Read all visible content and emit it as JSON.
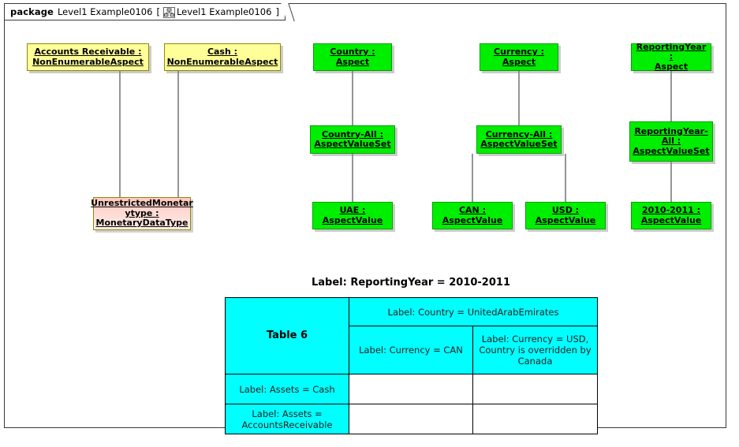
{
  "package": {
    "keyword": "package",
    "name": "Level1 Example0106",
    "open_bracket": "[",
    "close_bracket": "]",
    "tab_name": "Level1 Example0106",
    "icon": "class-diagram-icon"
  },
  "nodes": [
    {
      "id": "accounts-receivable",
      "line1": "Accounts Receivable :",
      "line2": "NonEnumerableAspect",
      "color": "#ffff99",
      "kind": "yellow"
    },
    {
      "id": "cash",
      "line1": "Cash :",
      "line2": "NonEnumerableAspect",
      "color": "#ffff99",
      "kind": "yellow"
    },
    {
      "id": "unrestricted-monetarytype",
      "line1": "UnrestrictedMonetar",
      "line2": "ytype :",
      "line3": "MonetaryDataType",
      "color": "#ffc9c0",
      "kind": "pink"
    },
    {
      "id": "country-aspect",
      "line1": "Country :",
      "line2": "Aspect",
      "color": "#00ee00",
      "kind": "green"
    },
    {
      "id": "country-all",
      "line1": "Country-All :",
      "line2": "AspectValueSet",
      "color": "#00ee00",
      "kind": "green"
    },
    {
      "id": "uae-aspectvalue",
      "line1": "UAE :",
      "line2": "AspectValue",
      "color": "#00ee00",
      "kind": "green"
    },
    {
      "id": "currency-aspect",
      "line1": "Currency :",
      "line2": "Aspect",
      "color": "#00ee00",
      "kind": "green"
    },
    {
      "id": "currency-all",
      "line1": "Currency-All :",
      "line2": "AspectValueSet",
      "color": "#00ee00",
      "kind": "green"
    },
    {
      "id": "can-aspectvalue",
      "line1": "CAN :",
      "line2": "AspectValue",
      "color": "#00ee00",
      "kind": "green"
    },
    {
      "id": "usd-aspectvalue",
      "line1": "USD :",
      "line2": "AspectValue",
      "color": "#00ee00",
      "kind": "green"
    },
    {
      "id": "reportingyear-aspect",
      "line1": "ReportingYear :",
      "line2": "Aspect",
      "color": "#00ee00",
      "kind": "green"
    },
    {
      "id": "reportingyear-all",
      "line1": "ReportingYear-",
      "line2": "All :",
      "line3": "AspectValueSet",
      "color": "#00ee00",
      "kind": "green"
    },
    {
      "id": "year-aspectvalue",
      "line1": "2010-2011 :",
      "line2": "AspectValue",
      "color": "#00ee00",
      "kind": "green"
    }
  ],
  "table": {
    "caption": "Label: ReportingYear = 2010-2011",
    "corner_label": "Table 6",
    "country_header": "Label: Country = UnitedArabEmirates",
    "currency_can": "Label: Currency = CAN",
    "currency_usd": "Label: Currency = USD, Country is overridden by Canada",
    "rows": [
      {
        "header": "Label: Assets = Cash",
        "cells": [
          "",
          ""
        ]
      },
      {
        "header": "Label: Assets = AccountsReceivable",
        "cells": [
          "",
          ""
        ]
      }
    ],
    "header_color": "#00ffff",
    "cell_color": "#ffffff"
  }
}
